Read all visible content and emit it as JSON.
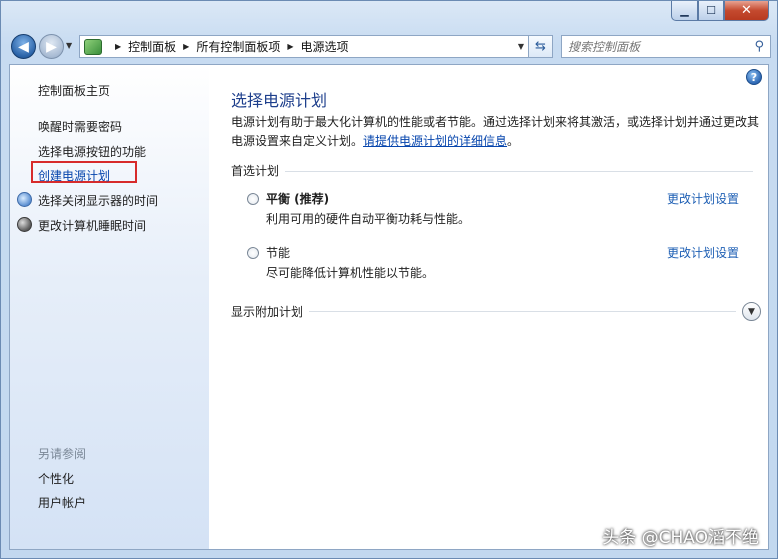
{
  "address": {
    "crumbs": [
      "控制面板",
      "所有控制面板项",
      "电源选项"
    ]
  },
  "search": {
    "placeholder": "搜索控制面板"
  },
  "sidebar": {
    "home": "控制面板主页",
    "links": [
      "唤醒时需要密码",
      "选择电源按钮的功能",
      "创建电源计划",
      "选择关闭显示器的时间",
      "更改计算机睡眠时间"
    ],
    "see_also_title": "另请参阅",
    "see_also": [
      "个性化",
      "用户帐户"
    ]
  },
  "main": {
    "title": "选择电源计划",
    "desc_line1": "电源计划有助于最大化计算机的性能或者节能。通过选择计划来将其激活，或选择计划并通过更改其",
    "desc_line2_prefix": "电源设置来自定义计划。",
    "desc_link": "请提供电源计划的详细信息",
    "desc_line2_suffix": "。",
    "preferred_title": "首选计划",
    "plans": [
      {
        "name": "平衡 (推荐)",
        "desc": "利用可用的硬件自动平衡功耗与性能。",
        "link": "更改计划设置"
      },
      {
        "name": "节能",
        "desc": "尽可能降低计算机性能以节能。",
        "link": "更改计划设置"
      }
    ],
    "more_plans": "显示附加计划"
  },
  "watermark": "头条 @CHAO滔不绝"
}
